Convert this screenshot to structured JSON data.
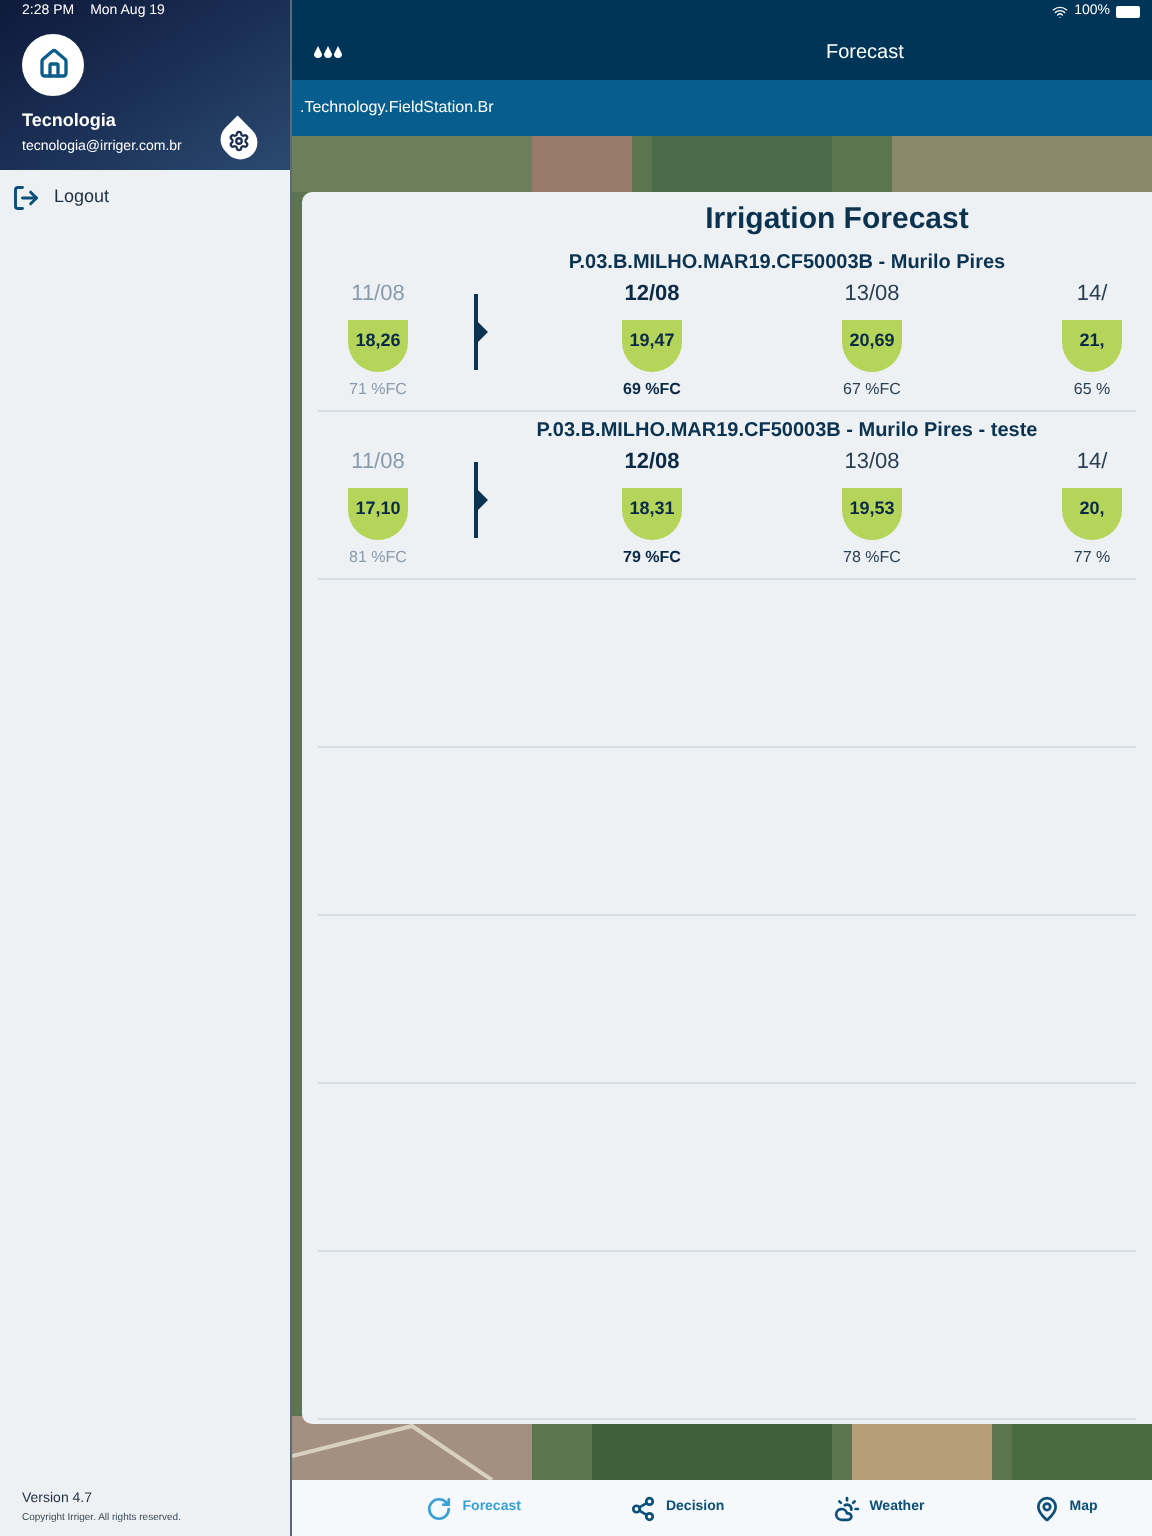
{
  "status_bar": {
    "time": "2:28 PM",
    "date": "Mon Aug 19",
    "battery": "100%"
  },
  "sidebar": {
    "user_name": "Tecnologia",
    "user_email": "tecnologia@irriger.com.br",
    "items": [
      {
        "label": "Logout"
      }
    ],
    "version": "Version  4.7",
    "copyright": "Copyright Irriger. All rights reserved."
  },
  "nav": {
    "title": "Forecast",
    "subtitle": ".Technology.FieldStation.Br"
  },
  "card": {
    "title": "Irrigation Forecast",
    "rows": [
      {
        "name": "P.03.B.MILHO.MAR19.CF50003B - Murilo Pires",
        "days": [
          {
            "kind": "past",
            "date": "11/08",
            "value": "18,26",
            "fc": "71 %FC"
          },
          {
            "kind": "today",
            "date": "12/08",
            "value": "19,47",
            "fc": "69 %FC"
          },
          {
            "kind": "future",
            "date": "13/08",
            "value": "20,69",
            "fc": "67 %FC"
          },
          {
            "kind": "future",
            "date": "14/",
            "value": "21,",
            "fc": "65 %"
          }
        ]
      },
      {
        "name": "P.03.B.MILHO.MAR19.CF50003B - Murilo Pires - teste",
        "days": [
          {
            "kind": "past",
            "date": "11/08",
            "value": "17,10",
            "fc": "81 %FC"
          },
          {
            "kind": "today",
            "date": "12/08",
            "value": "18,31",
            "fc": "79 %FC"
          },
          {
            "kind": "future",
            "date": "13/08",
            "value": "19,53",
            "fc": "78 %FC"
          },
          {
            "kind": "future",
            "date": "14/",
            "value": "20,",
            "fc": "77 %"
          }
        ]
      }
    ]
  },
  "tabs": [
    {
      "label": "Forecast",
      "selected": true
    },
    {
      "label": "Decision",
      "selected": false
    },
    {
      "label": "Weather",
      "selected": false
    },
    {
      "label": "Map",
      "selected": false
    }
  ]
}
